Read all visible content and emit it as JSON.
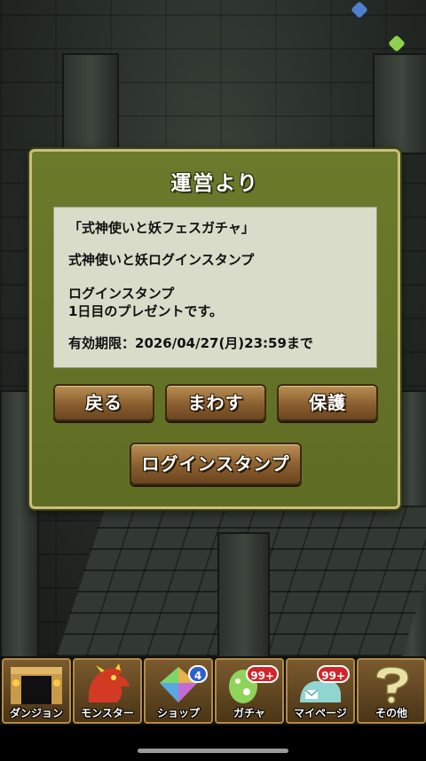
{
  "dialog": {
    "title": "運営より",
    "message": {
      "line1": "「式神使いと妖フェスガチャ」",
      "line2": "式神使いと妖ログインスタンプ",
      "line3": "ログインスタンプ",
      "line4": "1日目のプレゼントです。",
      "line5": "有効期限：2026/04/27(月)23:59まで"
    },
    "buttons": {
      "back": "戻る",
      "send": "まわす",
      "protect": "保護",
      "stamp": "ログインスタンプ"
    }
  },
  "nav": {
    "dungeon": {
      "label": "ダンジョン",
      "icon": "dungeon-gate-icon"
    },
    "monster": {
      "label": "モンスター",
      "icon": "red-dragon-icon"
    },
    "shop": {
      "label": "ショップ",
      "icon": "magic-stone-icon",
      "badge": "4"
    },
    "gacha": {
      "label": "ガチャ",
      "icon": "egg-icon",
      "badge": "99+"
    },
    "mypage": {
      "label": "マイページ",
      "icon": "mailbox-icon",
      "badge": "99+"
    },
    "other": {
      "label": "その他",
      "icon": "question-mark-icon"
    }
  },
  "colors": {
    "dialog_bg": "#667428",
    "button_brown": "#8a5f2f",
    "badge_blue": "#2c5fd1",
    "badge_red": "#d4242a"
  }
}
